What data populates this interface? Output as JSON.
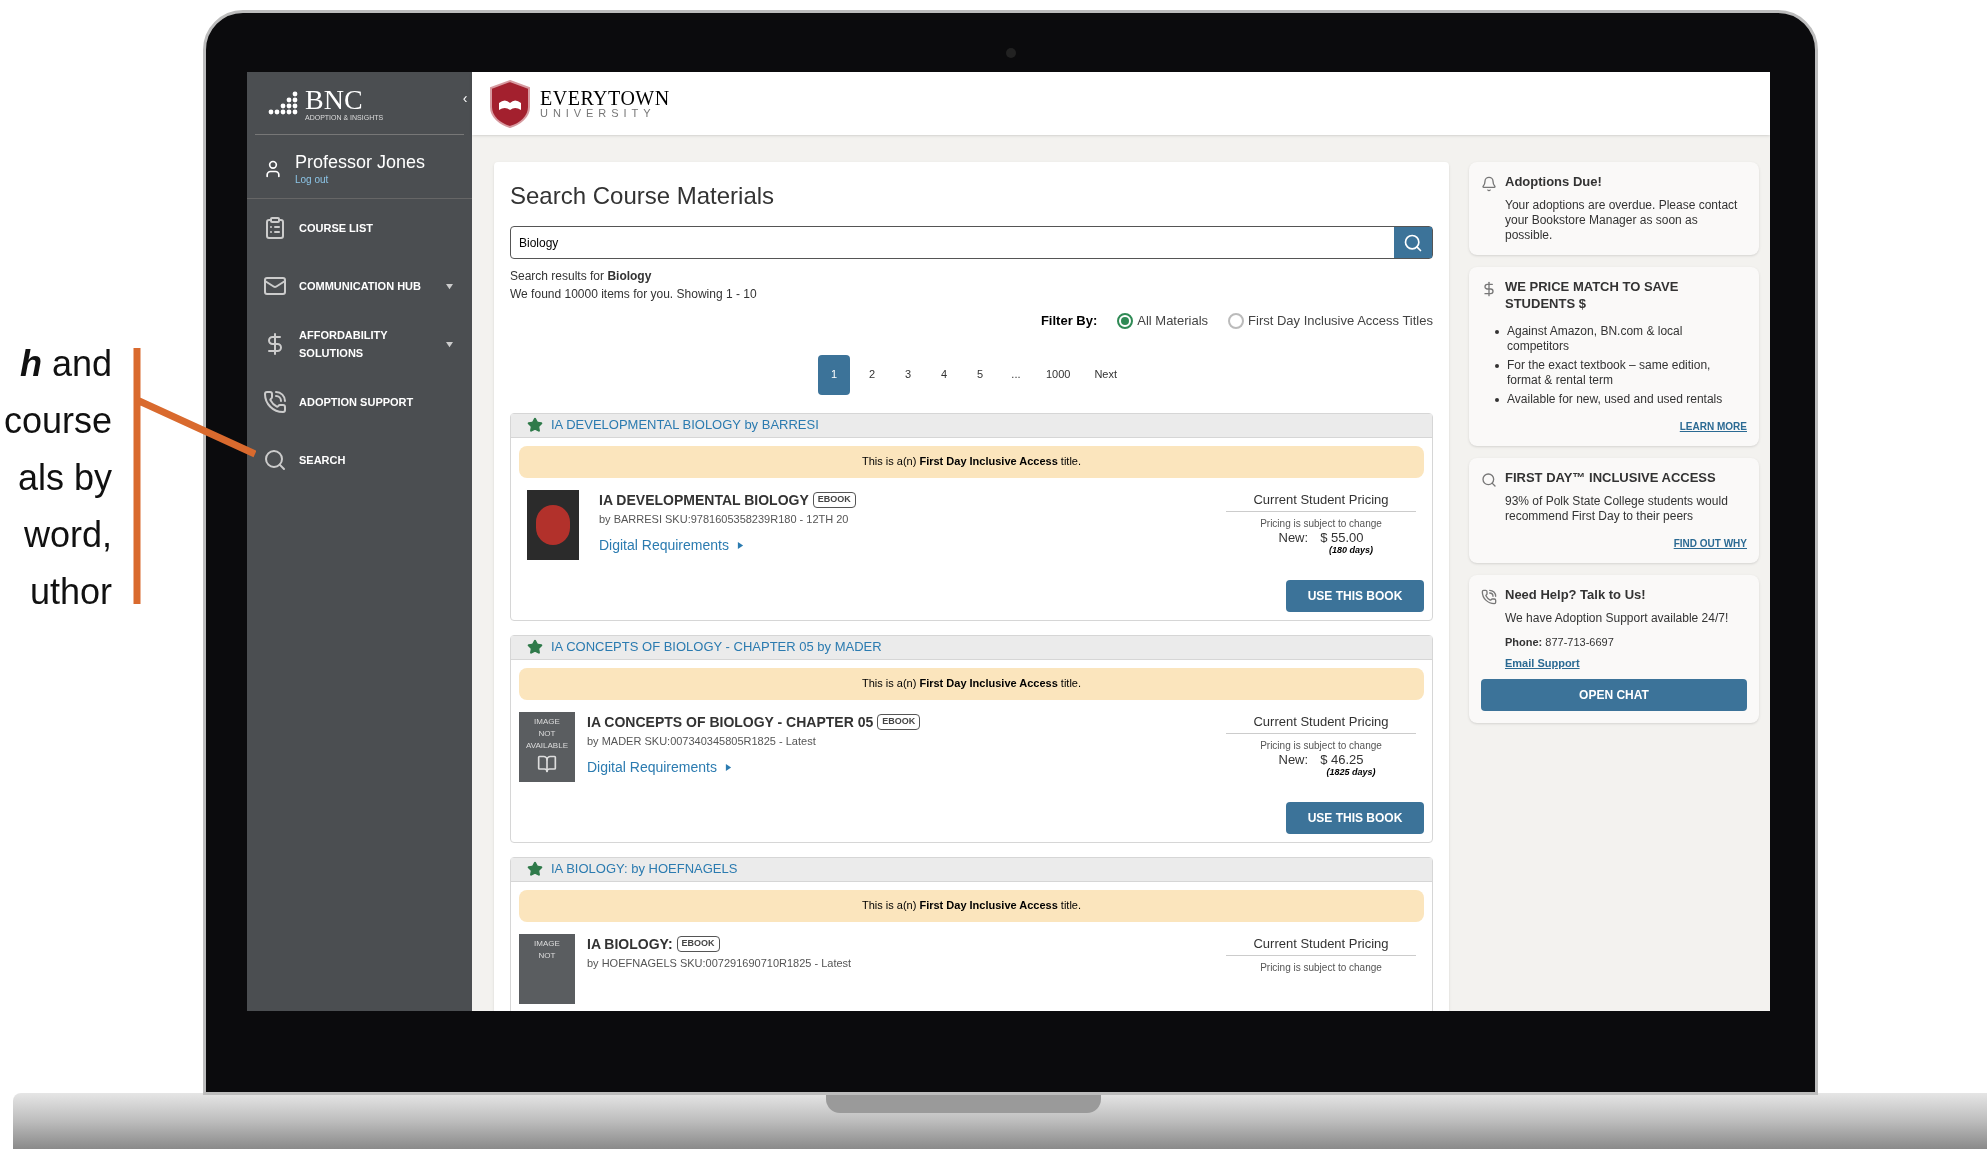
{
  "callout": {
    "lines": [
      "**h** and",
      "course",
      "als by",
      "word,",
      "uthor"
    ]
  },
  "sidebar": {
    "logo": {
      "mark": "BNC",
      "tagline": "ADOPTION & INSIGHTS"
    },
    "collapse": "‹",
    "user": {
      "name": "Professor Jones",
      "logout": "Log out"
    },
    "items": [
      {
        "label": "COURSE LIST",
        "dropdown": false
      },
      {
        "label": "COMMUNICATION HUB",
        "dropdown": true
      },
      {
        "label": "AFFORDABILITY SOLUTIONS",
        "dropdown": true
      },
      {
        "label": "ADOPTION SUPPORT",
        "dropdown": false
      },
      {
        "label": "SEARCH",
        "dropdown": false
      }
    ]
  },
  "header": {
    "school": "EVERYTOWN",
    "subtitle": "UNIVERSITY"
  },
  "search": {
    "title": "Search Course Materials",
    "value": "Biology",
    "results_for": "Search results for **Biology**",
    "found": "We found 10000 items for you. Showing 1 - 10",
    "filter_label": "Filter By:",
    "filters": [
      {
        "label": "All Materials",
        "selected": true
      },
      {
        "label": "First Day Inclusive Access Titles",
        "selected": false
      }
    ],
    "pages": [
      {
        "label": "1",
        "selected": true
      },
      {
        "label": "2",
        "selected": false
      },
      {
        "label": "3",
        "selected": false
      },
      {
        "label": "4",
        "selected": false
      },
      {
        "label": "5",
        "selected": false
      },
      {
        "label": "...",
        "selected": false
      },
      {
        "label": "1000",
        "selected": false
      },
      {
        "label": "Next",
        "selected": false
      }
    ]
  },
  "results": [
    {
      "heading": "IA DEVELOPMENTAL BIOLOGY by BARRESI",
      "banner": "This is a(n) **First Day Inclusive Access** title.",
      "image": {
        "kind": "cover"
      },
      "name": "IA DEVELOPMENTAL BIOLOGY",
      "badge": "EBOOK",
      "meta": "by BARRESI SKU:9781605358239R180 - 12TH 20",
      "link": "Digital Requirements",
      "pricing_title": "Current Student Pricing",
      "pricing_note": "Pricing is subject to change",
      "price_label": "New:",
      "price": "$ 55.00",
      "term": "(180 days)",
      "button": "USE THIS BOOK"
    },
    {
      "heading": "IA CONCEPTS OF BIOLOGY - CHAPTER 05 by MADER",
      "banner": "This is a(n) **First Day Inclusive Access** title.",
      "image": {
        "kind": "unavailable",
        "lines": [
          "IMAGE",
          "NOT",
          "AVAILABLE"
        ]
      },
      "name": "IA CONCEPTS OF BIOLOGY - CHAPTER 05",
      "badge": "EBOOK",
      "meta": "by MADER SKU:007340345805R1825 - Latest",
      "link": "Digital Requirements",
      "pricing_title": "Current Student Pricing",
      "pricing_note": "Pricing is subject to change",
      "price_label": "New:",
      "price": "$ 46.25",
      "term": "(1825 days)",
      "button": "USE THIS BOOK"
    },
    {
      "heading": "IA BIOLOGY: by HOEFNAGELS",
      "banner": "This is a(n) **First Day Inclusive Access** title.",
      "image": {
        "kind": "unavailable",
        "lines": [
          "IMAGE",
          "NOT"
        ]
      },
      "name": "IA BIOLOGY:",
      "badge": "EBOOK",
      "meta": "by HOEFNAGELS SKU:007291690710R1825 - Latest",
      "pricing_title": "Current Student Pricing",
      "pricing_note": "Pricing is subject to change"
    }
  ],
  "panels": [
    {
      "kind": "text",
      "title": "Adoptions Due!",
      "body": "Your adoptions are overdue. Please contact your Bookstore Manager as soon as possible."
    },
    {
      "kind": "list",
      "title": "WE PRICE MATCH TO SAVE STUDENTS $",
      "bullets": [
        "Against Amazon, BN.com & local competitors",
        "For the exact textbook – same edition, format & rental term",
        "Available for new, used and used rentals"
      ],
      "link": "LEARN MORE"
    },
    {
      "kind": "text",
      "title": "FIRST DAY™ INCLUSIVE ACCESS",
      "body": "93% of Polk State College students would recommend First Day to their peers",
      "link": "FIND OUT WHY"
    },
    {
      "kind": "contact",
      "title": "Need Help? Talk to Us!",
      "body": "We have Adoption Support available 24/7!",
      "phone": "**Phone:** 877-713-6697",
      "link": "Email Support",
      "button": "OPEN CHAT"
    }
  ]
}
